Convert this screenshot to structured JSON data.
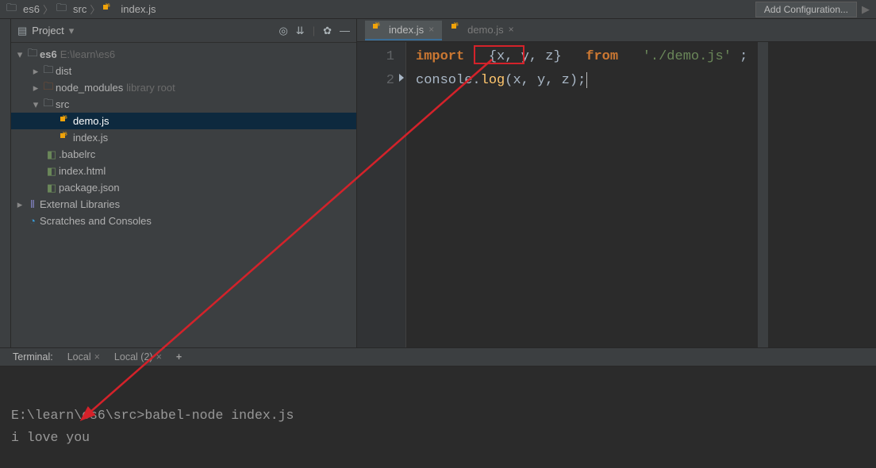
{
  "breadcrumb": {
    "p0": "es6",
    "p1": "src",
    "p2": "index.js"
  },
  "topbar": {
    "add_config": "Add Configuration..."
  },
  "project": {
    "title": "Project",
    "root_name": "es6",
    "root_path": "E:\\learn\\es6",
    "dist": "dist",
    "node_modules": "node_modules",
    "node_modules_hint": "library root",
    "src": "src",
    "demo_js": "demo.js",
    "index_js": "index.js",
    "babelrc": ".babelrc",
    "index_html": "index.html",
    "package_json": "package.json",
    "external_libs": "External Libraries",
    "scratches": "Scratches and Consoles"
  },
  "editor": {
    "tab_index": "index.js",
    "tab_demo": "demo.js",
    "line1_no": "1",
    "line2_no": "2",
    "kw_import": "import",
    "braces_inner": "{x, y, z}",
    "kw_from": "from",
    "str_path": "'./demo.js'",
    "semi": ";",
    "console": "console",
    "dot": ".",
    "log": "log",
    "open": "(",
    "args": "x, y, z",
    "close": ")",
    "semi2": ";"
  },
  "terminal": {
    "label": "Terminal:",
    "tab_local": "Local",
    "tab_local2": "Local (2)",
    "prompt_path": "E:\\learn\\es6\\src>",
    "command": "babel-node index.js",
    "output": "i love you"
  }
}
